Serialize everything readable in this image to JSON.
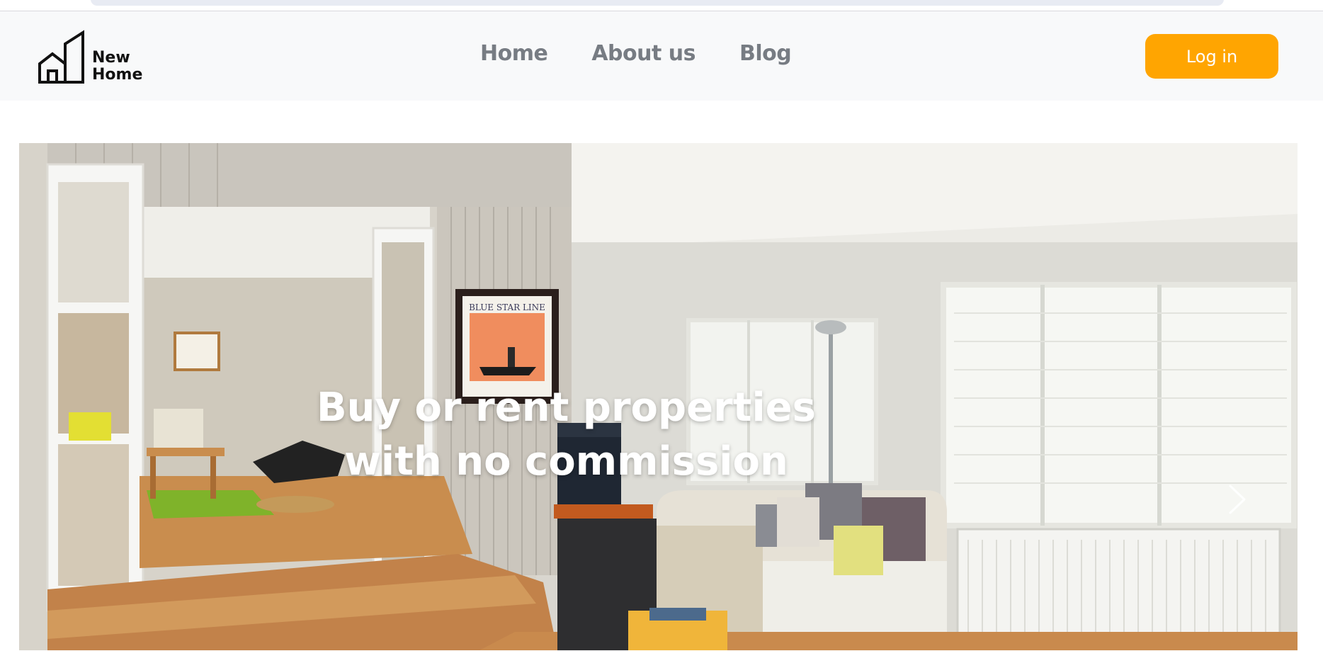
{
  "brand": {
    "name_line1": "New",
    "name_line2": "Home",
    "icon": "house-building-logo-icon"
  },
  "nav": {
    "items": [
      {
        "label": "Home"
      },
      {
        "label": "About us"
      },
      {
        "label": "Blog"
      }
    ]
  },
  "header": {
    "login_label": "Log in"
  },
  "hero": {
    "headline_line1": "Buy or rent properties",
    "headline_line2": "with no commission",
    "next_icon": "chevron-right-icon",
    "poster_text": "BLUE STAR LINE"
  },
  "colors": {
    "accent": "#ffa501",
    "nav_text": "#777c83",
    "header_bg": "#f8f9fa"
  }
}
